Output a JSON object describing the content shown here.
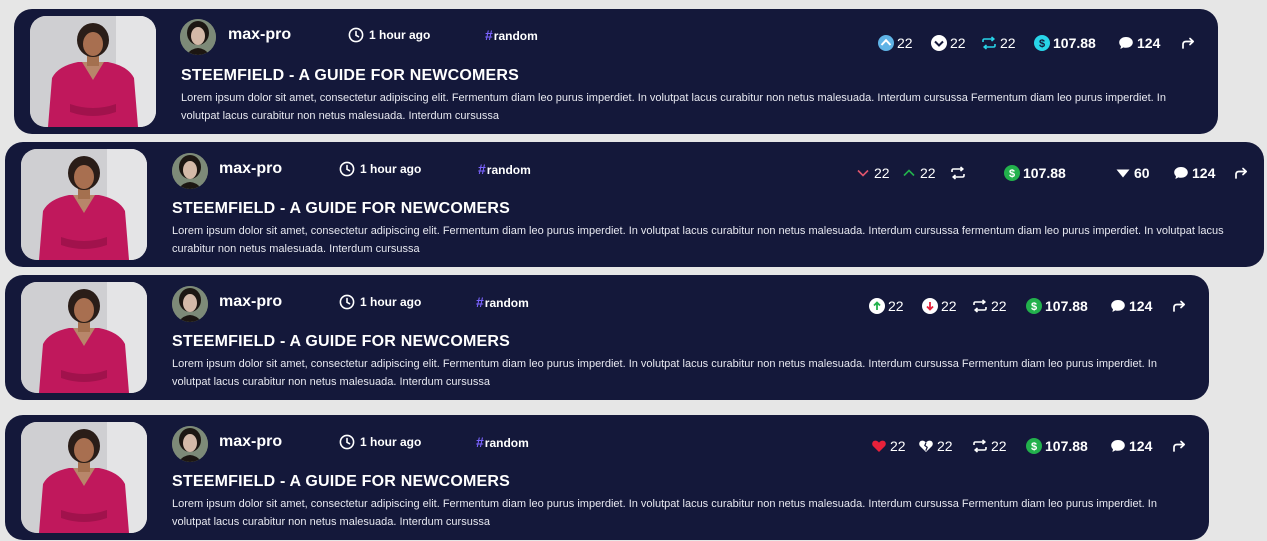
{
  "posts": [
    {
      "username": "max-pro",
      "time": "1 hour ago",
      "tag": "random",
      "title": "STEEMFIELD - A GUIDE FOR NEWCOMERS",
      "body": "Lorem ipsum dolor sit amet, consectetur adipiscing elit. Fermentum diam leo purus imperdiet. In volutpat lacus curabitur non netus malesuada. Interdum cursussa Fermentum diam leo purus imperdiet. In volutpat lacus curabitur non netus malesuada. Interdum cursussa",
      "stats": {
        "upvotes": "22",
        "downvotes": "22",
        "reposts": "22",
        "payout": "107.88",
        "comments": "124"
      },
      "icons": [
        "upvote-icon",
        "downvote-icon",
        "repost-icon",
        "dollar-icon",
        "comment-icon",
        "share-icon"
      ]
    },
    {
      "username": "max-pro",
      "time": "1 hour ago",
      "tag": "random",
      "title": "STEEMFIELD - A GUIDE FOR NEWCOMERS",
      "body": "Lorem ipsum dolor sit amet, consectetur adipiscing elit. Fermentum diam leo purus imperdiet. In volutpat lacus curabitur non netus malesuada. Interdum cursussa fermentum diam leo purus imperdiet. In volutpat lacus curabitur non netus malesuada. Interdum cursussa",
      "stats": {
        "downvotes": "22",
        "upvotes": "22",
        "payout": "107.88",
        "likes": "60",
        "comments": "124"
      },
      "icons": [
        "chevron-down-icon",
        "chevron-up-icon",
        "repost-icon",
        "dollar-icon",
        "heart-icon",
        "comment-icon",
        "share-icon"
      ]
    },
    {
      "username": "max-pro",
      "time": "1 hour ago",
      "tag": "random",
      "title": "STEEMFIELD - A GUIDE FOR NEWCOMERS",
      "body": "Lorem ipsum dolor sit amet, consectetur adipiscing elit. Fermentum diam leo purus imperdiet. In volutpat lacus curabitur non netus malesuada. Interdum cursussa Fermentum diam leo purus imperdiet. In volutpat lacus curabitur non netus malesuada. Interdum cursussa",
      "stats": {
        "upvotes": "22",
        "downvotes": "22",
        "reposts": "22",
        "payout": "107.88",
        "comments": "124"
      },
      "icons": [
        "up-arrow-icon",
        "down-arrow-icon",
        "repost-icon",
        "dollar-icon",
        "comment-icon",
        "share-icon"
      ]
    },
    {
      "username": "max-pro",
      "time": "1 hour ago",
      "tag": "random",
      "title": "STEEMFIELD - A GUIDE FOR NEWCOMERS",
      "body": "Lorem ipsum dolor sit amet, consectetur adipiscing elit. Fermentum diam leo purus imperdiet. In volutpat lacus curabitur non netus malesuada. Interdum cursussa Fermentum diam leo purus imperdiet. In volutpat lacus curabitur non netus malesuada. Interdum cursussa",
      "stats": {
        "likes": "22",
        "dislikes": "22",
        "reposts": "22",
        "payout": "107.88",
        "comments": "124"
      },
      "icons": [
        "heart-icon",
        "broken-heart-icon",
        "repost-icon",
        "dollar-icon",
        "comment-icon",
        "share-icon"
      ]
    }
  ],
  "colors": {
    "card": "#14183a",
    "page": "#e6e6e6",
    "tag_hash": "#7b63ff",
    "green": "#22b14c",
    "cyan": "#28d4e8",
    "red": "#e8213a"
  }
}
